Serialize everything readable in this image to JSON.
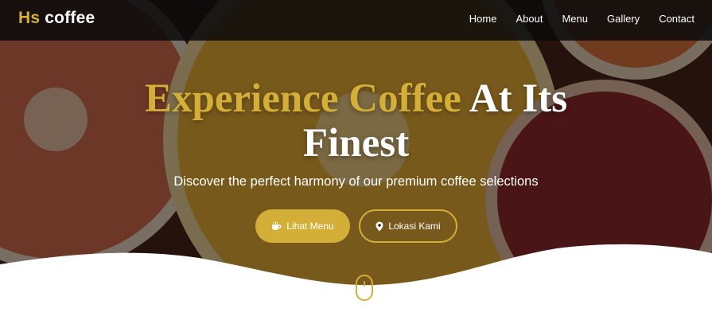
{
  "brand": {
    "accent": "Hs",
    "name": "coffee"
  },
  "nav": {
    "items": [
      "Home",
      "About",
      "Menu",
      "Gallery",
      "Contact"
    ]
  },
  "hero": {
    "title_gold": "Experience Coffee",
    "title_white_1": "At Its",
    "title_white_2": "Finest",
    "subtitle": "Discover the perfect harmony of our premium coffee selections"
  },
  "buttons": {
    "menu": {
      "label": "Lihat Menu",
      "icon": "coffee-cup-icon"
    },
    "location": {
      "label": "Lokasi Kami",
      "icon": "map-pin-icon"
    }
  },
  "scroll_indicator": {
    "icon": "mouse-icon"
  },
  "colors": {
    "accent": "#d4af37",
    "navbar": "#0a0a0a",
    "text": "#ffffff"
  }
}
